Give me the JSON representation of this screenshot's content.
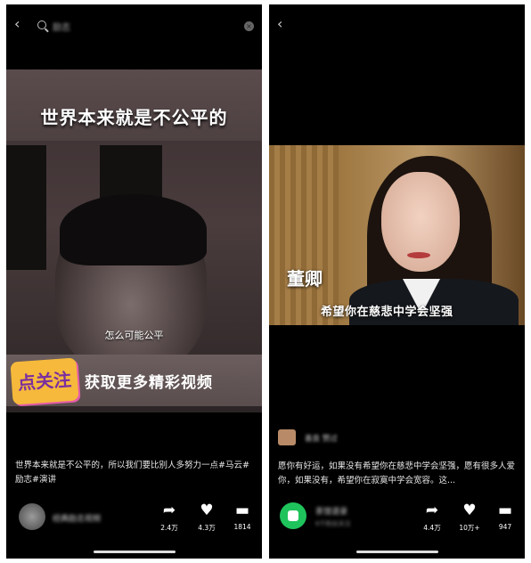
{
  "left_screen": {
    "back_glyph": "‹",
    "search_query": "励志",
    "clear_glyph": "×",
    "video": {
      "overlay_title": "世界本来就是不公平的",
      "subtitle": "怎么可能公平",
      "cta_logo_text": "点关注",
      "cta_text": "获取更多精彩视频"
    },
    "description": "世界本来就是不公平的，所以我们要比别人多努力一点#马云#励志#演讲",
    "author_name": "经典励志视频",
    "actions": [
      {
        "icon": "share-icon",
        "glyph": "➦",
        "count": "2.4万"
      },
      {
        "icon": "heart-icon",
        "glyph": "♥",
        "count": "4.3万"
      },
      {
        "icon": "comment-icon",
        "glyph": "▬",
        "count": "1814"
      }
    ]
  },
  "right_screen": {
    "back_glyph": "‹",
    "video": {
      "name_caption": "董卿",
      "subtitle": "希望你在慈悲中学会坚强"
    },
    "commenter_name": "善良 赞过",
    "description": "愿你有好运，如果没有希望你在慈悲中学会坚强，愿有很多人爱你，如果没有，希望你在寂寞中学会宽容。这...",
    "account_name": "茶馆语录",
    "account_sub": "6千粉丝关注",
    "actions": [
      {
        "icon": "share-icon",
        "glyph": "➦",
        "count": "4.4万"
      },
      {
        "icon": "heart-icon",
        "glyph": "♥",
        "count": "10万+"
      },
      {
        "icon": "comment-icon",
        "glyph": "▬",
        "count": "947"
      }
    ]
  }
}
